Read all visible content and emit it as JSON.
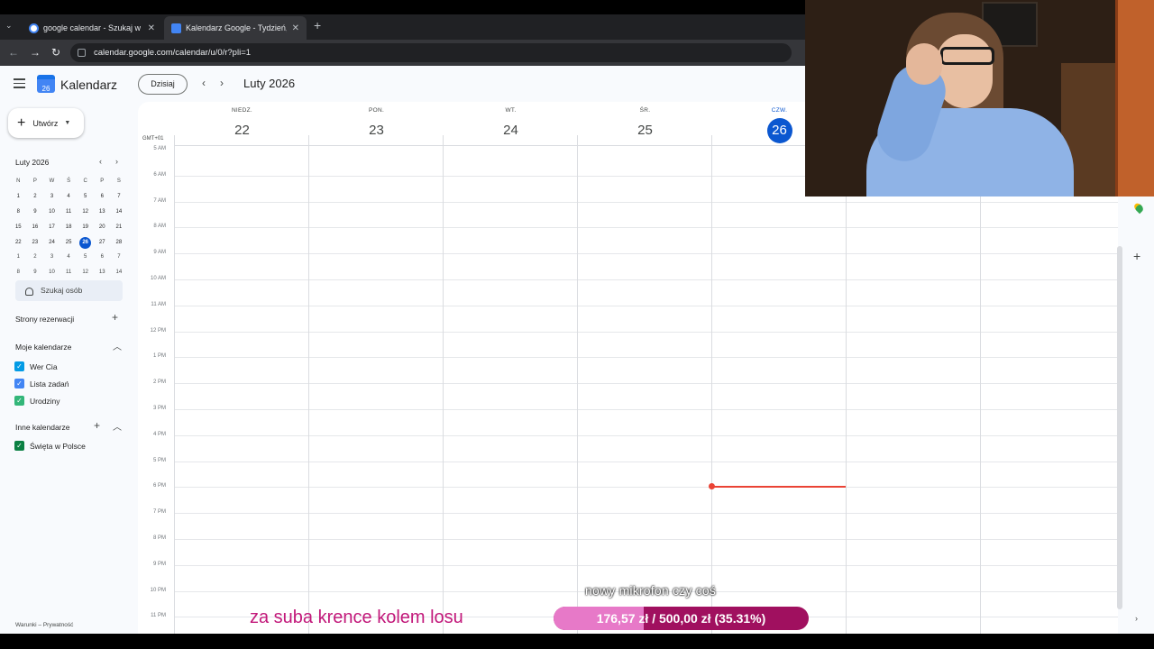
{
  "browser": {
    "tabs": [
      {
        "label": "google calendar - Szukaj w Goo",
        "favicon_color": "#ffffff"
      },
      {
        "label": "Kalendarz Google - Tydzień, w",
        "favicon_color": "#4285f4"
      }
    ],
    "url": "calendar.google.com/calendar/u/0/r?pli=1",
    "new_tab": "+",
    "close": "✕"
  },
  "header": {
    "app_name": "Kalendarz",
    "logo_day": "26",
    "today_label": "Dzisiaj",
    "title": "Luty 2026"
  },
  "sidebar": {
    "create_label": "Utwórz",
    "mini_calendar": {
      "title": "Luty 2026",
      "weekday_headers": [
        "N",
        "P",
        "W",
        "Ś",
        "C",
        "P",
        "S"
      ],
      "weeks": [
        [
          "1",
          "2",
          "3",
          "4",
          "5",
          "6",
          "7"
        ],
        [
          "8",
          "9",
          "10",
          "11",
          "12",
          "13",
          "14"
        ],
        [
          "15",
          "16",
          "17",
          "18",
          "19",
          "20",
          "21"
        ],
        [
          "22",
          "23",
          "24",
          "25",
          "26",
          "27",
          "28"
        ],
        [
          "1",
          "2",
          "3",
          "4",
          "5",
          "6",
          "7"
        ],
        [
          "8",
          "9",
          "10",
          "11",
          "12",
          "13",
          "14"
        ]
      ],
      "selected": "26"
    },
    "search_people": "Szukaj osób",
    "booking_pages": "Strony rezerwacji",
    "my_calendars": {
      "title": "Moje kalendarze",
      "items": [
        {
          "label": "Wer Cia",
          "color": "#039be5"
        },
        {
          "label": "Lista zadań",
          "color": "#4285f4"
        },
        {
          "label": "Urodziny",
          "color": "#33b679"
        }
      ]
    },
    "other_calendars": {
      "title": "Inne kalendarze",
      "items": [
        {
          "label": "Święta w Polsce",
          "color": "#0b8043"
        }
      ]
    },
    "footer": "Warunki – Prywatność"
  },
  "week": {
    "timezone": "GMT+01",
    "days": [
      {
        "weekday": "NIEDZ.",
        "date": "22",
        "current": false
      },
      {
        "weekday": "PON.",
        "date": "23",
        "current": false
      },
      {
        "weekday": "WT.",
        "date": "24",
        "current": false
      },
      {
        "weekday": "ŚR.",
        "date": "25",
        "current": false
      },
      {
        "weekday": "CZW.",
        "date": "26",
        "current": true
      }
    ],
    "hours": [
      "5 AM",
      "6 AM",
      "7 AM",
      "8 AM",
      "9 AM",
      "10 AM",
      "11 AM",
      "12 PM",
      "1 PM",
      "2 PM",
      "3 PM",
      "4 PM",
      "5 PM",
      "6 PM",
      "7 PM",
      "8 PM",
      "9 PM",
      "10 PM",
      "11 PM"
    ],
    "current_time_color": "#ea4335"
  },
  "overlay": {
    "subtitle": "za suba krence kolem losu",
    "goal_title": "nowy mikrofon czy coś",
    "goal_text": "176,57 zł / 500,00 zł (35.31%)",
    "goal_fraction": 0.3531,
    "accent_color": "#c2187a"
  }
}
